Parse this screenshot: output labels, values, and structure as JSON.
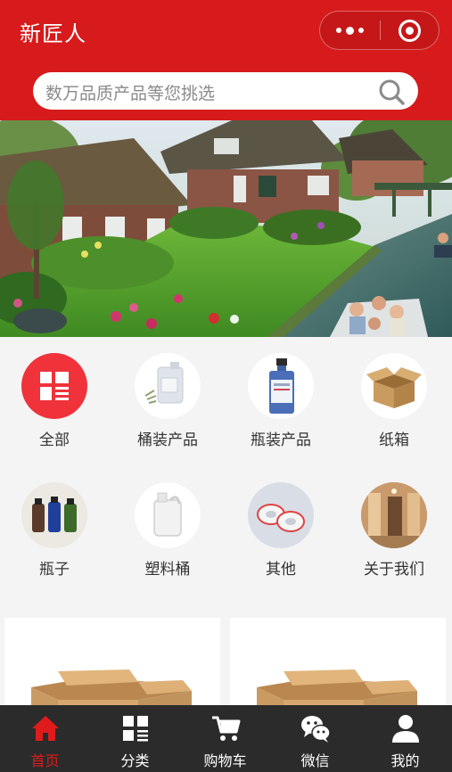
{
  "header": {
    "title": "新匠人",
    "capsule_more": "more-icon",
    "capsule_close": "target-icon"
  },
  "search": {
    "placeholder": "数万品质产品等您挑选",
    "icon": "search-icon"
  },
  "banner": {
    "image": "village-canal-photo",
    "slides": 1,
    "active_slide": 1
  },
  "categories": [
    {
      "label": "全部",
      "icon": "grid-icon"
    },
    {
      "label": "桶装产品",
      "icon": "bucket-product-icon"
    },
    {
      "label": "瓶装产品",
      "icon": "bottle-product-icon"
    },
    {
      "label": "纸箱",
      "icon": "carton-box-icon"
    },
    {
      "label": "瓶子",
      "icon": "bottles-icon"
    },
    {
      "label": "塑料桶",
      "icon": "plastic-jug-icon"
    },
    {
      "label": "其他",
      "icon": "tape-rolls-icon"
    },
    {
      "label": "关于我们",
      "icon": "about-room-icon"
    }
  ],
  "products": [
    {
      "image": "carton-box-image"
    },
    {
      "image": "carton-box-image"
    }
  ],
  "tabbar": {
    "items": [
      {
        "label": "首页",
        "icon": "home-icon",
        "active": true
      },
      {
        "label": "分类",
        "icon": "category-icon",
        "active": false
      },
      {
        "label": "购物车",
        "icon": "cart-icon",
        "active": false
      },
      {
        "label": "微信",
        "icon": "wechat-icon",
        "active": false
      },
      {
        "label": "我的",
        "icon": "user-icon",
        "active": false
      }
    ]
  },
  "colors": {
    "brand_red": "#d71a1b",
    "tab_active": "#e01b1b",
    "tabbar_bg": "#2b2b2b"
  }
}
